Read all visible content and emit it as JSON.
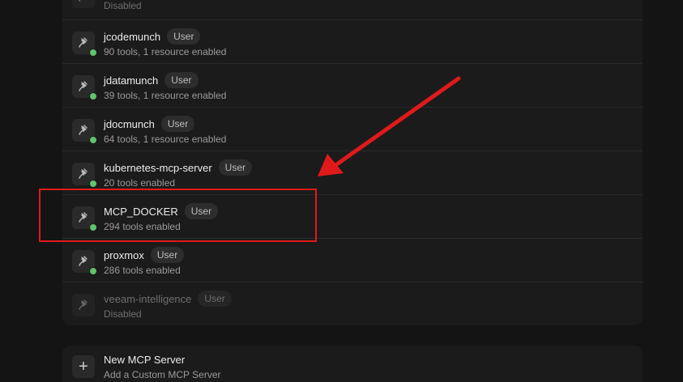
{
  "servers": [
    {
      "name": "",
      "badge": "",
      "sub": "Disabled",
      "enabled": false
    },
    {
      "name": "jcodemunch",
      "badge": "User",
      "sub": "90 tools, 1 resource enabled",
      "enabled": true
    },
    {
      "name": "jdatamunch",
      "badge": "User",
      "sub": "39 tools, 1 resource enabled",
      "enabled": true
    },
    {
      "name": "jdocmunch",
      "badge": "User",
      "sub": "64 tools, 1 resource enabled",
      "enabled": true
    },
    {
      "name": "kubernetes-mcp-server",
      "badge": "User",
      "sub": "20 tools enabled",
      "enabled": true
    },
    {
      "name": "MCP_DOCKER",
      "badge": "User",
      "sub": "294 tools enabled",
      "enabled": true
    },
    {
      "name": "proxmox",
      "badge": "User",
      "sub": "286 tools enabled",
      "enabled": true
    },
    {
      "name": "veeam-intelligence",
      "badge": "User",
      "sub": "Disabled",
      "enabled": false
    }
  ],
  "new_server": {
    "icon": "+",
    "title": "New MCP Server",
    "subtitle": "Add a Custom MCP Server"
  },
  "icons": {
    "server": "plug-icon",
    "add": "plus-icon"
  },
  "colors": {
    "status_enabled": "#5fc46a",
    "annotation": "#e01a1a"
  }
}
